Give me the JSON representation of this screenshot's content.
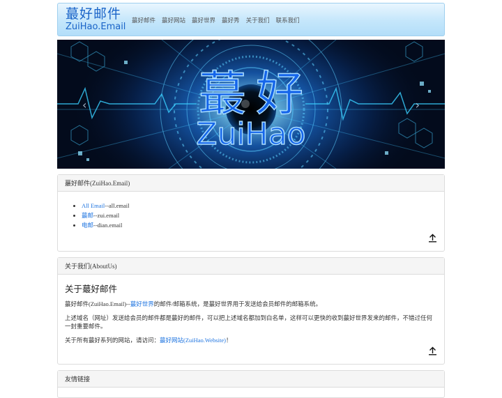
{
  "brand": {
    "name_cn": "蕞好邮件",
    "name_en": "ZuiHao.Email"
  },
  "nav": [
    "蕞好邮件",
    "蕞好网站",
    "蕞好世界",
    "蕞好秀",
    "关于我们",
    "联系我们"
  ],
  "banner": {
    "title_cn": "蕞好",
    "title_en": "ZuiHao"
  },
  "section1": {
    "heading": "蕞好邮件(ZuiHao.Email)",
    "items": [
      {
        "link": "All Email",
        "suffix": "--all.email"
      },
      {
        "link": "蕞邮",
        "suffix": "--zui.email"
      },
      {
        "link": "电邮",
        "suffix": "--dian.email"
      }
    ]
  },
  "section2": {
    "heading": "关于我们(AboutUs)",
    "title": "关于蕞好邮件",
    "p1_a": "蕞好邮件(ZuiHao.Email)--",
    "p1_link": "蕞好世界",
    "p1_b": "的邮件/邮箱系统，是蕞好世界用于发送给会员邮件的邮箱系统。",
    "p2": "上述域名（网址）发送给会员的邮件都是蕞好的邮件，可以把上述域名都加到白名单，这样可以更快的收到蕞好世界发来的邮件，不错过任何一封重要邮件。",
    "p3_a": "关于所有蕞好系列的网站，请访问：",
    "p3_link": "蕞好网站(ZuiHao.Website)",
    "p3_b": "！"
  },
  "section3": {
    "heading": "友情链接"
  }
}
